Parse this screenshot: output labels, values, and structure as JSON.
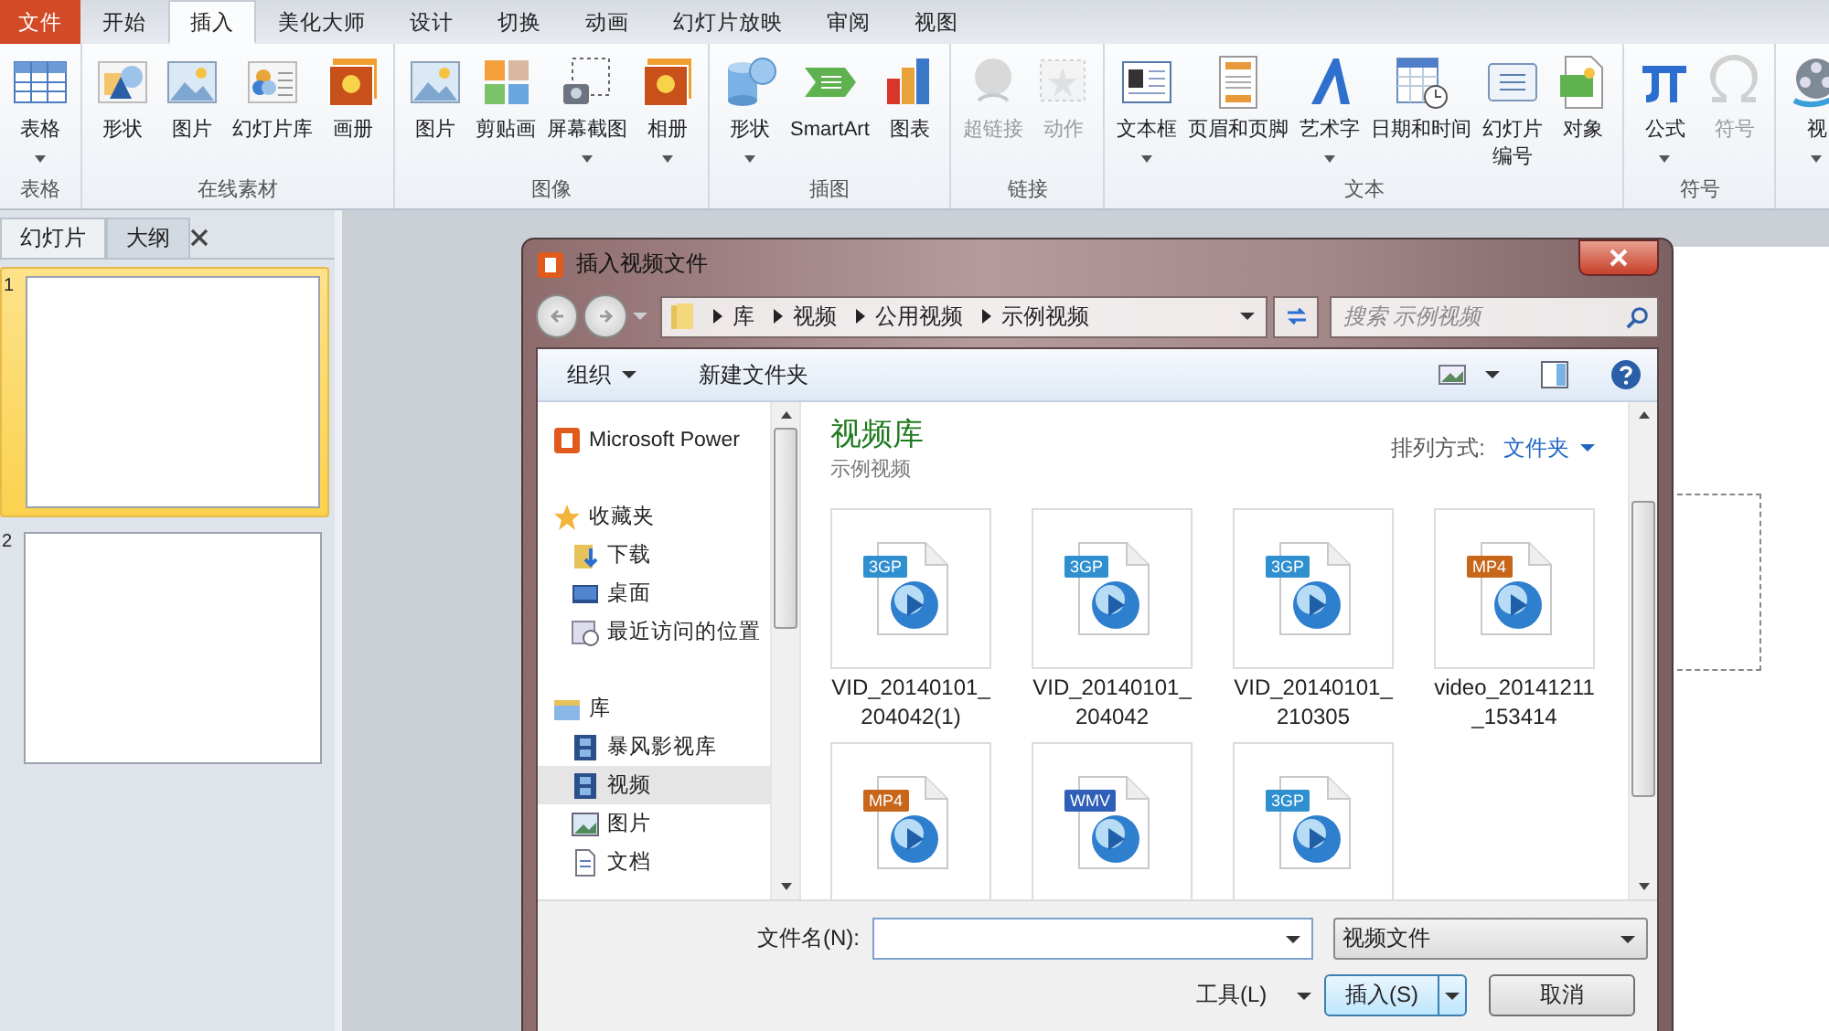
{
  "menu_tabs": [
    {
      "label": "文件",
      "kind": "file",
      "selected": false
    },
    {
      "label": "开始",
      "kind": "tab",
      "selected": false
    },
    {
      "label": "插入",
      "kind": "tab",
      "selected": true
    },
    {
      "label": "美化大师",
      "kind": "tab",
      "selected": false
    },
    {
      "label": "设计",
      "kind": "tab",
      "selected": false
    },
    {
      "label": "切换",
      "kind": "tab",
      "selected": false
    },
    {
      "label": "动画",
      "kind": "tab",
      "selected": false
    },
    {
      "label": "幻灯片放映",
      "kind": "tab",
      "selected": false
    },
    {
      "label": "审阅",
      "kind": "tab",
      "selected": false
    },
    {
      "label": "视图",
      "kind": "tab",
      "selected": false
    }
  ],
  "ribbon": {
    "groups": [
      {
        "label": "表格",
        "buttons": [
          {
            "label": "表格",
            "caret": true,
            "disabled": false
          }
        ]
      },
      {
        "label": "在线素材",
        "buttons": [
          {
            "label": "形状",
            "caret": false,
            "disabled": false
          },
          {
            "label": "图片",
            "caret": false,
            "disabled": false
          },
          {
            "label": "幻灯片库",
            "caret": false,
            "disabled": false
          },
          {
            "label": "画册",
            "caret": false,
            "disabled": false
          }
        ]
      },
      {
        "label": "图像",
        "buttons": [
          {
            "label": "图片",
            "caret": false,
            "disabled": false
          },
          {
            "label": "剪贴画",
            "caret": false,
            "disabled": false
          },
          {
            "label": "屏幕截图",
            "caret": true,
            "disabled": false
          },
          {
            "label": "相册",
            "caret": true,
            "disabled": false
          }
        ]
      },
      {
        "label": "插图",
        "buttons": [
          {
            "label": "形状",
            "caret": true,
            "disabled": false
          },
          {
            "label": "SmartArt",
            "caret": false,
            "disabled": false
          },
          {
            "label": "图表",
            "caret": false,
            "disabled": false
          }
        ]
      },
      {
        "label": "链接",
        "buttons": [
          {
            "label": "超链接",
            "caret": false,
            "disabled": true
          },
          {
            "label": "动作",
            "caret": false,
            "disabled": true
          }
        ]
      },
      {
        "label": "文本",
        "buttons": [
          {
            "label": "文本框",
            "caret": true,
            "disabled": false
          },
          {
            "label": "页眉和页脚",
            "caret": false,
            "disabled": false
          },
          {
            "label": "艺术字",
            "caret": true,
            "disabled": false
          },
          {
            "label": "日期和时间",
            "caret": false,
            "disabled": false
          },
          {
            "lines": [
              "幻灯片",
              "编号"
            ],
            "caret": false,
            "disabled": false
          },
          {
            "label": "对象",
            "caret": false,
            "disabled": false
          }
        ]
      },
      {
        "label": "符号",
        "buttons": [
          {
            "label": "公式",
            "caret": true,
            "disabled": false
          },
          {
            "label": "符号",
            "caret": false,
            "disabled": true
          }
        ]
      },
      {
        "buttons": [
          {
            "label": "视",
            "caret": true,
            "disabled": false
          }
        ]
      }
    ]
  },
  "slides_panel": {
    "tabs": [
      {
        "label": "幻灯片",
        "selected": true
      },
      {
        "label": "大纲",
        "selected": false
      }
    ],
    "slides": [
      {
        "number": "1",
        "selected": true
      },
      {
        "number": "2",
        "selected": false
      }
    ]
  },
  "dialog": {
    "title": "插入视频文件",
    "breadcrumbs": [
      "库",
      "视频",
      "公用视频",
      "示例视频"
    ],
    "search": {
      "placeholder": "搜索 示例视频"
    },
    "toolbar": {
      "organize": "组织",
      "new_folder": "新建文件夹"
    },
    "nav_tree": [
      {
        "label": "Microsoft Power",
        "selected": false
      },
      {
        "label": "收藏夹",
        "selected": false,
        "children": [
          {
            "label": "下载",
            "selected": false
          },
          {
            "label": "桌面",
            "selected": false
          },
          {
            "label": "最近访问的位置",
            "selected": false
          }
        ]
      },
      {
        "label": "库",
        "selected": false,
        "children": [
          {
            "label": "暴风影视库",
            "selected": false
          },
          {
            "label": "视频",
            "selected": true
          },
          {
            "label": "图片",
            "selected": false
          },
          {
            "label": "文档",
            "selected": false
          }
        ]
      }
    ],
    "library": {
      "title": "视频库",
      "subtitle": "示例视频",
      "arrange_label": "排列方式:",
      "arrange_value": "文件夹"
    },
    "files": [
      {
        "tag": "3GP",
        "color": "#2f8fcf",
        "name": "VID_20140101_\n204042(1)"
      },
      {
        "tag": "3GP",
        "color": "#2f8fcf",
        "name": "VID_20140101_\n204042"
      },
      {
        "tag": "3GP",
        "color": "#2f8fcf",
        "name": "VID_20140101_\n210305"
      },
      {
        "tag": "MP4",
        "color": "#c8661a",
        "name": "video_20141211\n_153414"
      },
      {
        "tag": "MP4",
        "color": "#c8661a"
      },
      {
        "tag": "WMV",
        "color": "#2f5fb8"
      },
      {
        "tag": "3GP",
        "color": "#2f8fcf"
      }
    ],
    "filename": {
      "label": "文件名(N):"
    },
    "filetype": "视频文件",
    "tools": "工具(L)",
    "insert": "插入(S)",
    "cancel": "取消"
  }
}
